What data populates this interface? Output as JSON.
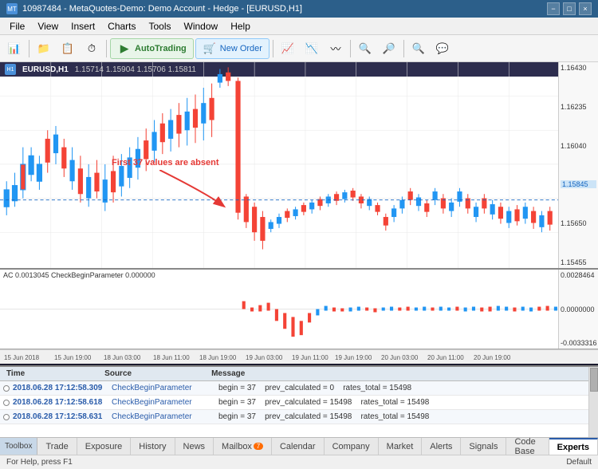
{
  "titlebar": {
    "title": "10987484 - MetaQuotes-Demo: Demo Account - Hedge - [EURUSD,H1]",
    "icon": "MT",
    "controls": [
      "−",
      "□",
      "×"
    ]
  },
  "menubar": {
    "items": [
      "File",
      "View",
      "Insert",
      "Charts",
      "Tools",
      "Window",
      "Help"
    ]
  },
  "toolbar": {
    "autotrading_label": "AutoTrading",
    "neworder_label": "New Order"
  },
  "chart": {
    "symbol": "EURUSD,H1",
    "prices": "1.15714  1.15904  1.15706  1.15811",
    "price_axis": [
      "1.16430",
      "1.16235",
      "1.16040",
      "1.15845",
      "1.15650",
      "1.15455"
    ],
    "current_price": "1.15845",
    "annotation": "First 37 values are absent",
    "indicator_label": "AC  0.0013045  CheckBeginParameter  0.000000",
    "indicator_axis": [
      "0.0028464",
      "0.0000000",
      "-0.0033316"
    ],
    "xaxis_labels": [
      "15 Jun 2018",
      "15 Jun 19:00",
      "18 Jun 03:00",
      "18 Jun 11:00",
      "18 Jun 19:00",
      "19 Jun 03:00",
      "19 Jun 11:00",
      "19 Jun 19:00",
      "20 Jun 03:00",
      "20 Jun 11:00",
      "20 Jun 19:00"
    ]
  },
  "log": {
    "columns": [
      "Time",
      "Source",
      "Message"
    ],
    "rows": [
      {
        "time": "2018.06.28 17:12:58.309",
        "source": "CheckBeginParameter",
        "message": "begin = 37    prev_calculated = 0    rates_total = 15498"
      },
      {
        "time": "2018.06.28 17:12:58.618",
        "source": "CheckBeginParameter",
        "message": "begin = 37    prev_calculated = 15498    rates_total = 15498"
      },
      {
        "time": "2018.06.28 17:12:58.631",
        "source": "CheckBeginParameter",
        "message": "begin = 37    prev_calculated = 15498    rates_total = 15498"
      }
    ]
  },
  "tabs": {
    "toolbox_label": "Toolbox",
    "items": [
      {
        "label": "Trade",
        "active": false
      },
      {
        "label": "Exposure",
        "active": false
      },
      {
        "label": "History",
        "active": false
      },
      {
        "label": "News",
        "active": false
      },
      {
        "label": "Mailbox",
        "active": false,
        "badge": "7"
      },
      {
        "label": "Calendar",
        "active": false
      },
      {
        "label": "Company",
        "active": false
      },
      {
        "label": "Market",
        "active": false
      },
      {
        "label": "Alerts",
        "active": false
      },
      {
        "label": "Signals",
        "active": false
      },
      {
        "label": "Code Base",
        "active": false
      },
      {
        "label": "Experts",
        "active": true
      }
    ]
  },
  "statusbar": {
    "left": "For Help, press F1",
    "center": "",
    "right": "Default"
  },
  "colors": {
    "bull": "#2196F3",
    "bear": "#F44336",
    "accent": "#2a5caa",
    "green": "#4caf50"
  }
}
